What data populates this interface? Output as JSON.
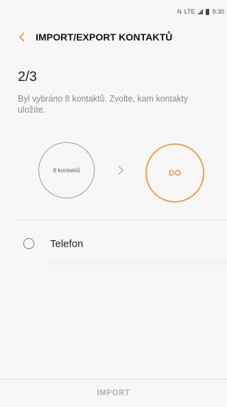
{
  "status_bar": {
    "nfc": "N",
    "network": "LTE",
    "time": "9:30"
  },
  "header": {
    "title": "IMPORT/EXPORT KONTAKTŮ",
    "back_icon": "chevron-left-icon",
    "accent_color": "#f0a04a"
  },
  "step": {
    "label": "2/3",
    "description": "Byl vybráno 8 kontaktů. Zvolte, kam kontakty uložíte."
  },
  "flow": {
    "from_label": "8 kontaktů",
    "to_label": "DO",
    "arrow_icon": "chevron-right-icon"
  },
  "options": [
    {
      "label": "Telefon",
      "selected": false
    }
  ],
  "footer": {
    "import_label": "IMPORT",
    "enabled": false
  }
}
